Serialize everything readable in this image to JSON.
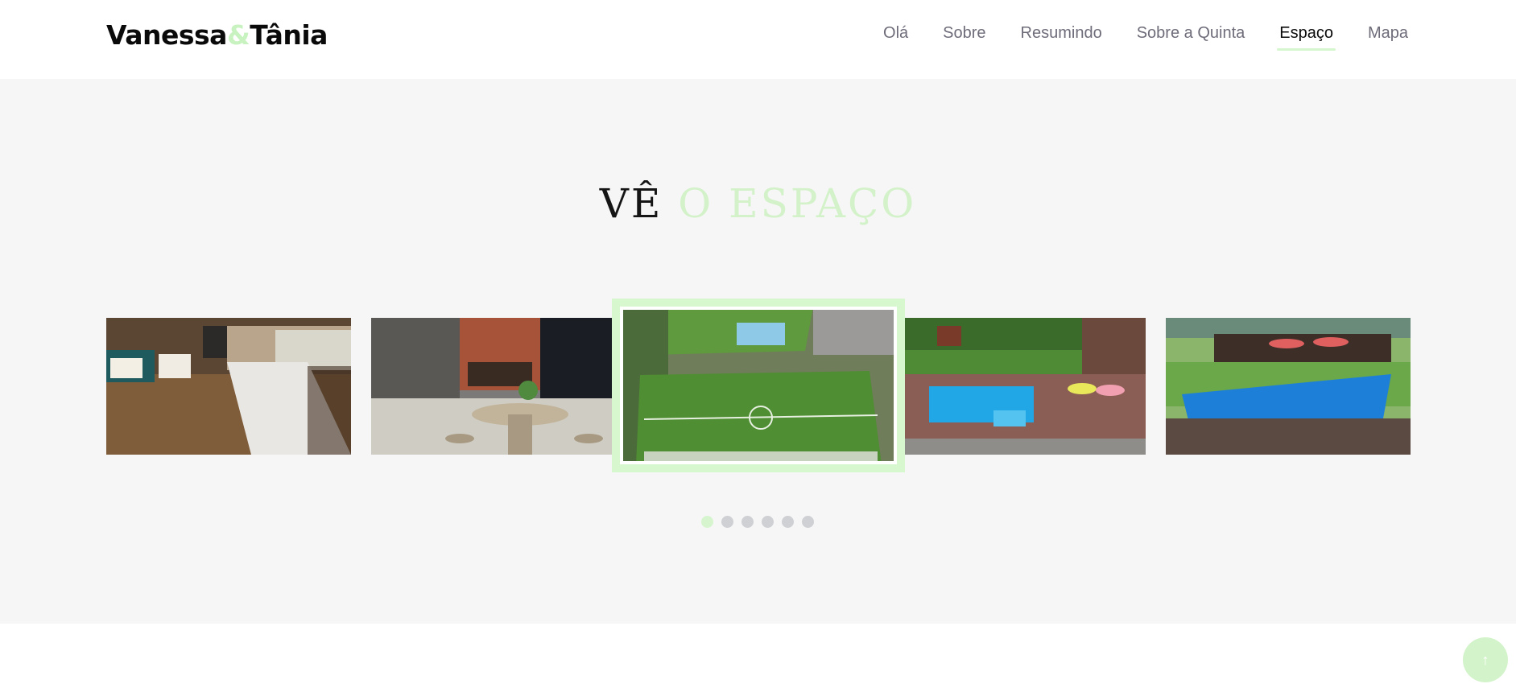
{
  "brand": {
    "part1": "Vanessa",
    "amp": "&",
    "part2": "Tânia"
  },
  "nav": {
    "items": [
      {
        "label": "Olá"
      },
      {
        "label": "Sobre"
      },
      {
        "label": "Resumindo"
      },
      {
        "label": "Sobre a Quinta"
      },
      {
        "label": "Espaço"
      },
      {
        "label": "Mapa"
      }
    ],
    "active": "Espaço"
  },
  "gallery": {
    "title_dark": "VÊ",
    "title_light": "O ESPAÇO",
    "active_slide": 3,
    "dots_count": 6,
    "active_dot": 1
  },
  "scroll_top": {
    "icon": "arrow-up-icon",
    "glyph": "↑"
  },
  "colors": {
    "accent": "#d6f5cf",
    "section_bg": "#f6f6f6",
    "nav_text": "#6f6c7a"
  }
}
